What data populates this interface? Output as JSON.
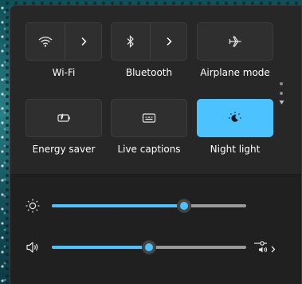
{
  "quick_settings": {
    "tiles": [
      {
        "id": "wifi",
        "label": "Wi-Fi",
        "icon": "wifi-icon",
        "type": "split",
        "active": false
      },
      {
        "id": "bluetooth",
        "label": "Bluetooth",
        "icon": "bluetooth-icon",
        "type": "split",
        "active": false
      },
      {
        "id": "airplane",
        "label": "Airplane mode",
        "icon": "airplane-icon",
        "type": "single",
        "active": false
      },
      {
        "id": "energy",
        "label": "Energy saver",
        "icon": "battery-saver-icon",
        "type": "single",
        "active": false
      },
      {
        "id": "captions",
        "label": "Live captions",
        "icon": "captions-icon",
        "type": "single",
        "active": false
      },
      {
        "id": "night",
        "label": "Night light",
        "icon": "night-light-icon",
        "type": "single",
        "active": true
      }
    ],
    "page_indicator": {
      "pages": 2,
      "current": 1
    }
  },
  "sliders": {
    "brightness": {
      "icon": "brightness-icon",
      "value_percent": 68
    },
    "volume": {
      "icon": "speaker-icon",
      "value_percent": 50,
      "output_icon": "audio-output-icon"
    }
  },
  "colors": {
    "accent": "#4cc2ff",
    "panel_bg": "#202020",
    "tile_bg": "#2f2f2f"
  }
}
